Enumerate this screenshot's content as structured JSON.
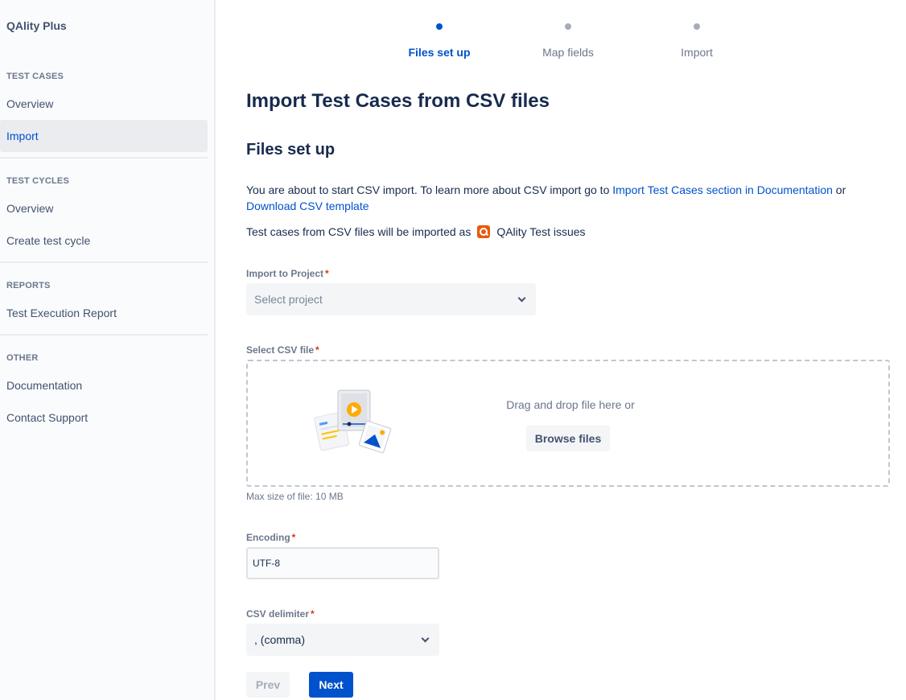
{
  "sidebar": {
    "app_title": "QAlity Plus",
    "sections": [
      {
        "title": "TEST CASES",
        "items": [
          {
            "label": "Overview"
          },
          {
            "label": "Import",
            "active": true
          }
        ]
      },
      {
        "title": "TEST CYCLES",
        "items": [
          {
            "label": "Overview"
          },
          {
            "label": "Create test cycle"
          }
        ]
      },
      {
        "title": "REPORTS",
        "items": [
          {
            "label": "Test Execution Report"
          }
        ]
      },
      {
        "title": "OTHER",
        "items": [
          {
            "label": "Documentation"
          },
          {
            "label": "Contact Support"
          }
        ]
      }
    ]
  },
  "stepper": {
    "steps": [
      {
        "label": "Files set up",
        "active": true
      },
      {
        "label": "Map fields",
        "active": false
      },
      {
        "label": "Import",
        "active": false
      }
    ]
  },
  "page": {
    "title": "Import Test Cases from CSV files",
    "section_heading": "Files set up",
    "intro_text": "You are about to start CSV import. To learn more about CSV import go to",
    "doc_link": "Import Test Cases section in Documentation",
    "or_text": "or",
    "template_link": "Download CSV template",
    "import_as_text": "Test cases from CSV files will be imported as",
    "issue_type": "QAlity Test issues"
  },
  "form": {
    "project": {
      "label": "Import to Project",
      "required": "*",
      "placeholder": "Select project"
    },
    "csv_file": {
      "label": "Select CSV file",
      "required": "*",
      "drop_text": "Drag and drop file here or",
      "browse_label": "Browse files",
      "help_text": "Max size of file: 10 MB"
    },
    "encoding": {
      "label": "Encoding",
      "required": "*",
      "value": "UTF-8"
    },
    "delimiter": {
      "label": "CSV delimiter",
      "required": "*",
      "value": ", (comma)"
    }
  },
  "actions": {
    "prev_label": "Prev",
    "next_label": "Next"
  },
  "colors": {
    "accent": "#0052cc",
    "required": "#de350b",
    "qality_brand": "#e8590c"
  }
}
